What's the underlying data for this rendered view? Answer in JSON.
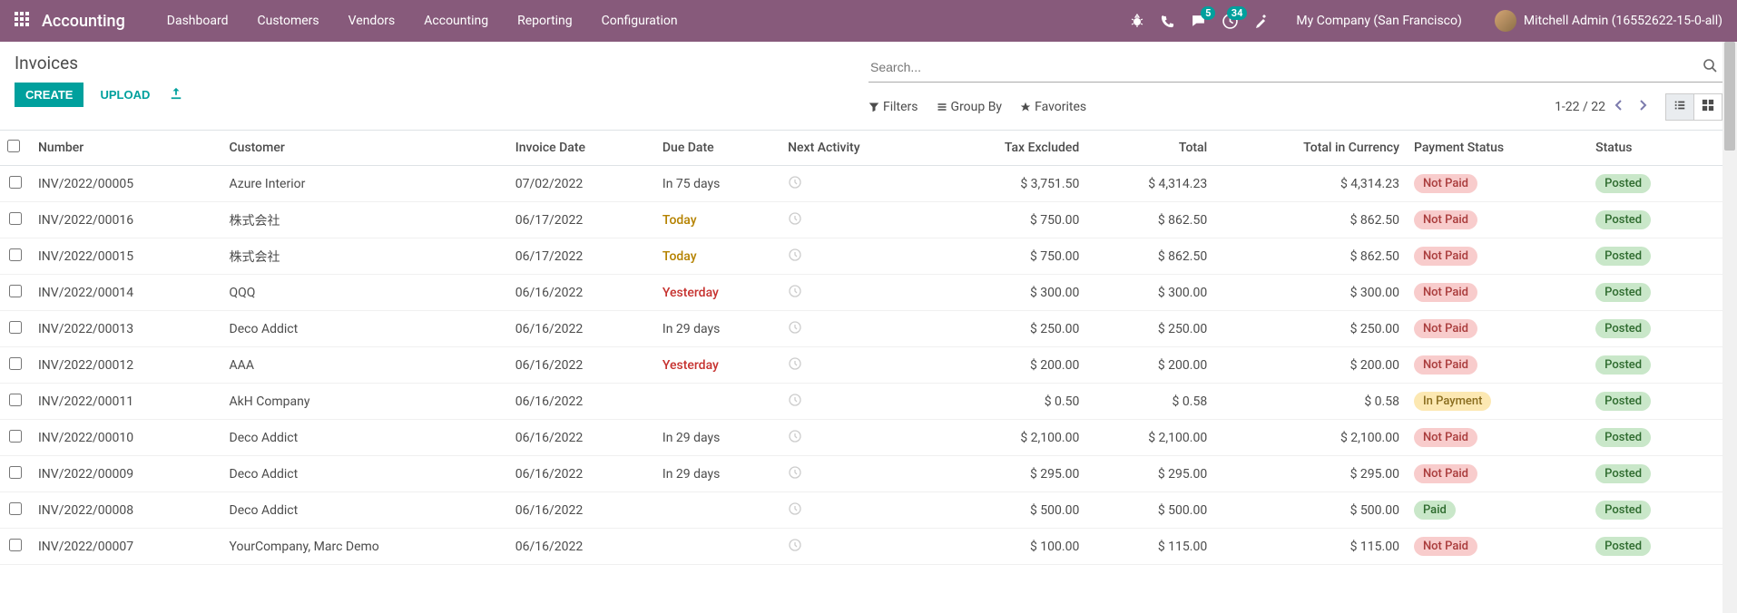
{
  "topbar": {
    "brand": "Accounting",
    "nav": [
      "Dashboard",
      "Customers",
      "Vendors",
      "Accounting",
      "Reporting",
      "Configuration"
    ],
    "messages_badge": "5",
    "activities_badge": "34",
    "company": "My Company (San Francisco)",
    "user": "Mitchell Admin (16552622-15-0-all)"
  },
  "page": {
    "title": "Invoices",
    "create_label": "CREATE",
    "upload_label": "UPLOAD"
  },
  "search": {
    "placeholder": "Search...",
    "filters_label": "Filters",
    "groupby_label": "Group By",
    "favorites_label": "Favorites",
    "pager": "1-22 / 22"
  },
  "columns": {
    "number": "Number",
    "customer": "Customer",
    "invoice_date": "Invoice Date",
    "due_date": "Due Date",
    "next_activity": "Next Activity",
    "tax_excluded": "Tax Excluded",
    "total": "Total",
    "total_currency": "Total in Currency",
    "payment_status": "Payment Status",
    "status": "Status"
  },
  "payment_labels": {
    "not_paid": "Not Paid",
    "in_payment": "In Payment",
    "paid": "Paid"
  },
  "status_labels": {
    "posted": "Posted"
  },
  "rows": [
    {
      "number": "INV/2022/00005",
      "customer": "Azure Interior",
      "invoice_date": "07/02/2022",
      "due": "In 75 days",
      "due_class": "",
      "tax": "$ 3,751.50",
      "total": "$ 4,314.23",
      "total_cur": "$ 4,314.23",
      "pay": "not_paid",
      "status": "posted"
    },
    {
      "number": "INV/2022/00016",
      "customer": "株式会社",
      "invoice_date": "06/17/2022",
      "due": "Today",
      "due_class": "due-today",
      "tax": "$ 750.00",
      "total": "$ 862.50",
      "total_cur": "$ 862.50",
      "pay": "not_paid",
      "status": "posted"
    },
    {
      "number": "INV/2022/00015",
      "customer": "株式会社",
      "invoice_date": "06/17/2022",
      "due": "Today",
      "due_class": "due-today",
      "tax": "$ 750.00",
      "total": "$ 862.50",
      "total_cur": "$ 862.50",
      "pay": "not_paid",
      "status": "posted"
    },
    {
      "number": "INV/2022/00014",
      "customer": "QQQ",
      "invoice_date": "06/16/2022",
      "due": "Yesterday",
      "due_class": "due-past",
      "tax": "$ 300.00",
      "total": "$ 300.00",
      "total_cur": "$ 300.00",
      "pay": "not_paid",
      "status": "posted"
    },
    {
      "number": "INV/2022/00013",
      "customer": "Deco Addict",
      "invoice_date": "06/16/2022",
      "due": "In 29 days",
      "due_class": "",
      "tax": "$ 250.00",
      "total": "$ 250.00",
      "total_cur": "$ 250.00",
      "pay": "not_paid",
      "status": "posted"
    },
    {
      "number": "INV/2022/00012",
      "customer": "AAA",
      "invoice_date": "06/16/2022",
      "due": "Yesterday",
      "due_class": "due-past",
      "tax": "$ 200.00",
      "total": "$ 200.00",
      "total_cur": "$ 200.00",
      "pay": "not_paid",
      "status": "posted"
    },
    {
      "number": "INV/2022/00011",
      "customer": "AkH Company",
      "invoice_date": "06/16/2022",
      "due": "",
      "due_class": "",
      "tax": "$ 0.50",
      "total": "$ 0.58",
      "total_cur": "$ 0.58",
      "pay": "in_payment",
      "status": "posted"
    },
    {
      "number": "INV/2022/00010",
      "customer": "Deco Addict",
      "invoice_date": "06/16/2022",
      "due": "In 29 days",
      "due_class": "",
      "tax": "$ 2,100.00",
      "total": "$ 2,100.00",
      "total_cur": "$ 2,100.00",
      "pay": "not_paid",
      "status": "posted"
    },
    {
      "number": "INV/2022/00009",
      "customer": "Deco Addict",
      "invoice_date": "06/16/2022",
      "due": "In 29 days",
      "due_class": "",
      "tax": "$ 295.00",
      "total": "$ 295.00",
      "total_cur": "$ 295.00",
      "pay": "not_paid",
      "status": "posted"
    },
    {
      "number": "INV/2022/00008",
      "customer": "Deco Addict",
      "invoice_date": "06/16/2022",
      "due": "",
      "due_class": "",
      "tax": "$ 500.00",
      "total": "$ 500.00",
      "total_cur": "$ 500.00",
      "pay": "paid",
      "status": "posted"
    },
    {
      "number": "INV/2022/00007",
      "customer": "YourCompany, Marc Demo",
      "invoice_date": "06/16/2022",
      "due": "",
      "due_class": "",
      "tax": "$ 100.00",
      "total": "$ 115.00",
      "total_cur": "$ 115.00",
      "pay": "not_paid",
      "status": "posted"
    }
  ]
}
